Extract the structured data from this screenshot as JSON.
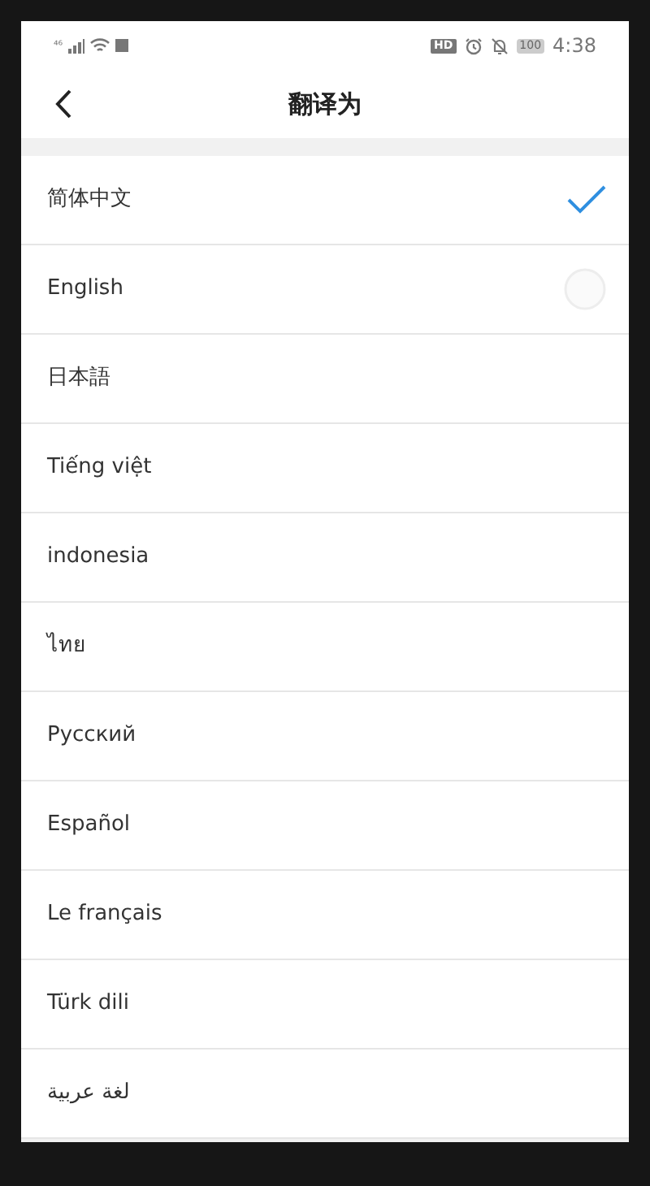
{
  "status_bar": {
    "network": "⁴⁶",
    "hd": "HD",
    "battery": "100",
    "time": "4:38"
  },
  "header": {
    "title": "翻译为"
  },
  "languages": [
    {
      "label": "简体中文",
      "selected": true,
      "pressed": false
    },
    {
      "label": "English",
      "selected": false,
      "pressed": true
    },
    {
      "label": "日本語",
      "selected": false,
      "pressed": false
    },
    {
      "label": "Tiếng việt",
      "selected": false,
      "pressed": false
    },
    {
      "label": "indonesia",
      "selected": false,
      "pressed": false
    },
    {
      "label": "ไทย",
      "selected": false,
      "pressed": false
    },
    {
      "label": "Русский",
      "selected": false,
      "pressed": false
    },
    {
      "label": "Español",
      "selected": false,
      "pressed": false
    },
    {
      "label": "Le français",
      "selected": false,
      "pressed": false
    },
    {
      "label": "Türk dili",
      "selected": false,
      "pressed": false
    },
    {
      "label": "لغة عربية",
      "selected": false,
      "pressed": false
    }
  ]
}
